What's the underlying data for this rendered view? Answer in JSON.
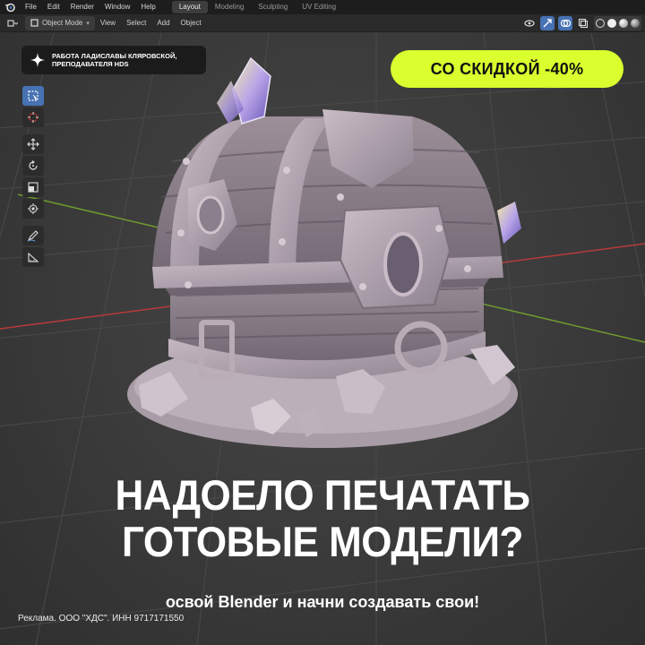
{
  "menubar": {
    "items": [
      "File",
      "Edit",
      "Render",
      "Window",
      "Help"
    ],
    "workspaces": [
      "Layout",
      "Modeling",
      "Sculpting",
      "UV Editing"
    ],
    "active_workspace": "Layout"
  },
  "header": {
    "mode": "Object Mode",
    "menus": [
      "View",
      "Select",
      "Add",
      "Object"
    ]
  },
  "credit": {
    "line1": "РАБОТА ЛАДИСЛАВЫ КЛЯРОВСКОЙ,",
    "line2": "ПРЕПОДАВАТЕЛЯ HDS"
  },
  "promo": {
    "discount": "СО СКИДКОЙ -40%"
  },
  "headline": {
    "line1": "НАДОЕЛО ПЕЧАТАТЬ",
    "line2": "ГОТОВЫЕ МОДЕЛИ?",
    "subline": "освой Blender и начни создавать свои!"
  },
  "disclaimer": "Реклама. ООО \"ХДС\". ИНН 9717171550",
  "colors": {
    "accent_lime": "#d9ff2e",
    "blender_active": "#4772b3",
    "axis_red": "#b83a3a",
    "axis_green": "#6f9a2f"
  },
  "toolbar_icons": [
    "select-box-icon",
    "cursor-icon",
    "move-icon",
    "rotate-icon",
    "scale-icon",
    "transform-icon",
    "annotate-icon",
    "measure-icon"
  ]
}
